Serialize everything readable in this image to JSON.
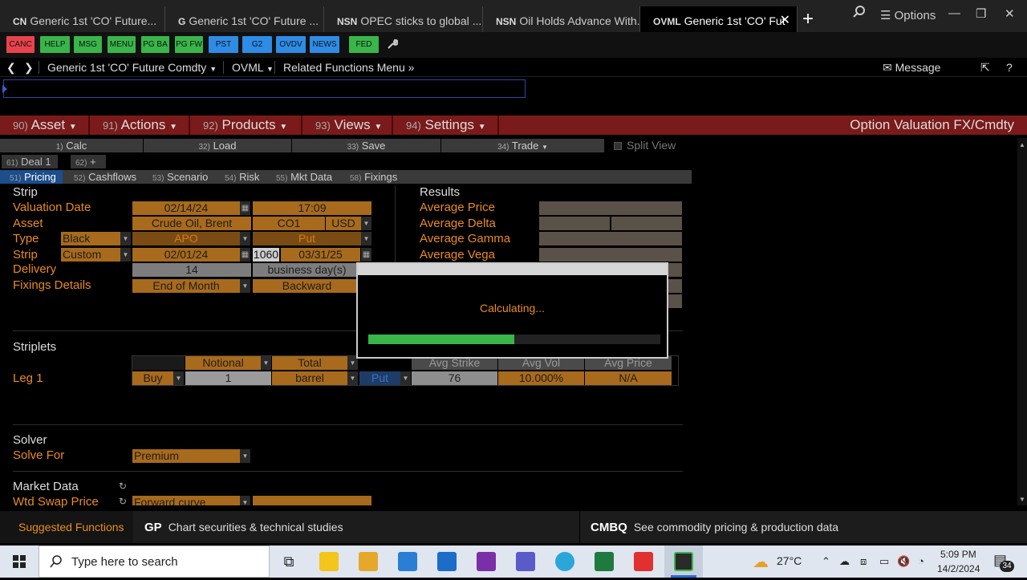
{
  "tabs": [
    {
      "prefix": "CN",
      "label": "Generic 1st 'CO' Future...",
      "active": false
    },
    {
      "prefix": "G",
      "label": "Generic 1st 'CO' Future ...",
      "active": false
    },
    {
      "prefix": "NSN",
      "label": "OPEC sticks to global ...",
      "active": false
    },
    {
      "prefix": "NSN",
      "label": "Oil Holds Advance With...",
      "active": false
    },
    {
      "prefix": "OVML",
      "label": "Generic 1st 'CO' Fut",
      "active": true
    }
  ],
  "window": {
    "options_label": "Options",
    "new_tab": "+",
    "close": "✕"
  },
  "toolbar": {
    "buttons": [
      {
        "label": "CANC",
        "color": "#e8434d"
      },
      {
        "label": "HELP",
        "color": "#39b54a"
      },
      {
        "label": "MSG",
        "color": "#39b54a"
      },
      {
        "label": "MENU",
        "color": "#39b54a"
      },
      {
        "label": "PG BA",
        "color": "#39b54a"
      },
      {
        "label": "PG FW",
        "color": "#39b54a"
      },
      {
        "label": "PST",
        "color": "#2e8ce6"
      },
      {
        "label": "G2",
        "color": "#2e8ce6"
      },
      {
        "label": "OVDV",
        "color": "#2e8ce6"
      },
      {
        "label": "NEWS",
        "color": "#2e8ce6"
      },
      {
        "label": "FED",
        "color": "#39b54a"
      }
    ]
  },
  "nav": {
    "security": "Generic 1st 'CO' Future Comdty",
    "function": "OVML",
    "related": "Related Functions Menu",
    "message": "Message",
    "help": "?"
  },
  "menu": {
    "items": [
      {
        "num": "90)",
        "label": "Asset"
      },
      {
        "num": "91)",
        "label": "Actions"
      },
      {
        "num": "92)",
        "label": "Products"
      },
      {
        "num": "93)",
        "label": "Views"
      },
      {
        "num": "94)",
        "label": "Settings"
      }
    ],
    "title": "Option Valuation FX/Cmdty"
  },
  "actions": [
    {
      "num": "1)",
      "label": "Calc"
    },
    {
      "num": "32)",
      "label": "Load"
    },
    {
      "num": "33)",
      "label": "Save"
    },
    {
      "num": "34)",
      "label": "Trade"
    }
  ],
  "split_view": "Split View",
  "deal_tabs": [
    {
      "num": "61)",
      "label": "Deal 1"
    },
    {
      "num": "62)",
      "label": "+"
    }
  ],
  "sub_tabs": [
    {
      "num": "51)",
      "label": "Pricing"
    },
    {
      "num": "52)",
      "label": "Cashflows"
    },
    {
      "num": "53)",
      "label": "Scenario"
    },
    {
      "num": "54)",
      "label": "Risk"
    },
    {
      "num": "55)",
      "label": "Mkt Data"
    },
    {
      "num": "58)",
      "label": "Fixings"
    }
  ],
  "strip": {
    "heading": "Strip",
    "labels": {
      "valuation_date": "Valuation Date",
      "asset": "Asset",
      "type": "Type",
      "strip": "Strip",
      "delivery": "Delivery",
      "fixings": "Fixings Details"
    },
    "valuation_date": "02/14/24",
    "valuation_time": "17:09",
    "asset_name": "Crude Oil, Brent",
    "asset_ticker": "CO1",
    "currency": "USD",
    "type_model": "Black",
    "type_product": "APO",
    "type_option": "Put",
    "strip_mode": "Custom",
    "strip_start": "02/01/24",
    "strip_num": "1060",
    "strip_end": "03/31/25",
    "delivery_days": "14",
    "delivery_unit": "business day(s)",
    "fixing_freq": "End of Month",
    "fixing_dir": "Backward"
  },
  "results": {
    "heading": "Results",
    "labels": [
      "Average Price",
      "Average Delta",
      "Average Gamma",
      "Average Vega"
    ]
  },
  "striplets": {
    "heading": "Striplets",
    "col_notional": "Notional",
    "col_total": "Total",
    "col_avg_strike": "Avg Strike",
    "col_avg_vol": "Avg Vol",
    "col_avg_price": "Avg Price",
    "leg_label": "Leg 1",
    "side": "Buy",
    "notional": "1",
    "unit": "barrel",
    "option": "Put",
    "avg_strike": "76",
    "avg_vol": "10.000%",
    "avg_price": "N/A"
  },
  "solver": {
    "heading": "Solver",
    "solve_for_label": "Solve For",
    "solve_for": "Premium"
  },
  "market": {
    "heading": "Market Data",
    "wtd_label": "Wtd Swap Price",
    "wtd_value": "Forward curve"
  },
  "modal": {
    "text": "Calculating...",
    "progress": 0.5
  },
  "bottom": {
    "suggested": "Suggested Functions",
    "f1_code": "GP",
    "f1_desc": "Chart securities & technical studies",
    "f2_code": "CMBQ",
    "f2_desc": "See commodity pricing & production data"
  },
  "taskbar": {
    "search_placeholder": "Type here to search",
    "temp": "27°C",
    "time": "5:09 PM",
    "date": "14/2/2024",
    "notif": "34"
  }
}
